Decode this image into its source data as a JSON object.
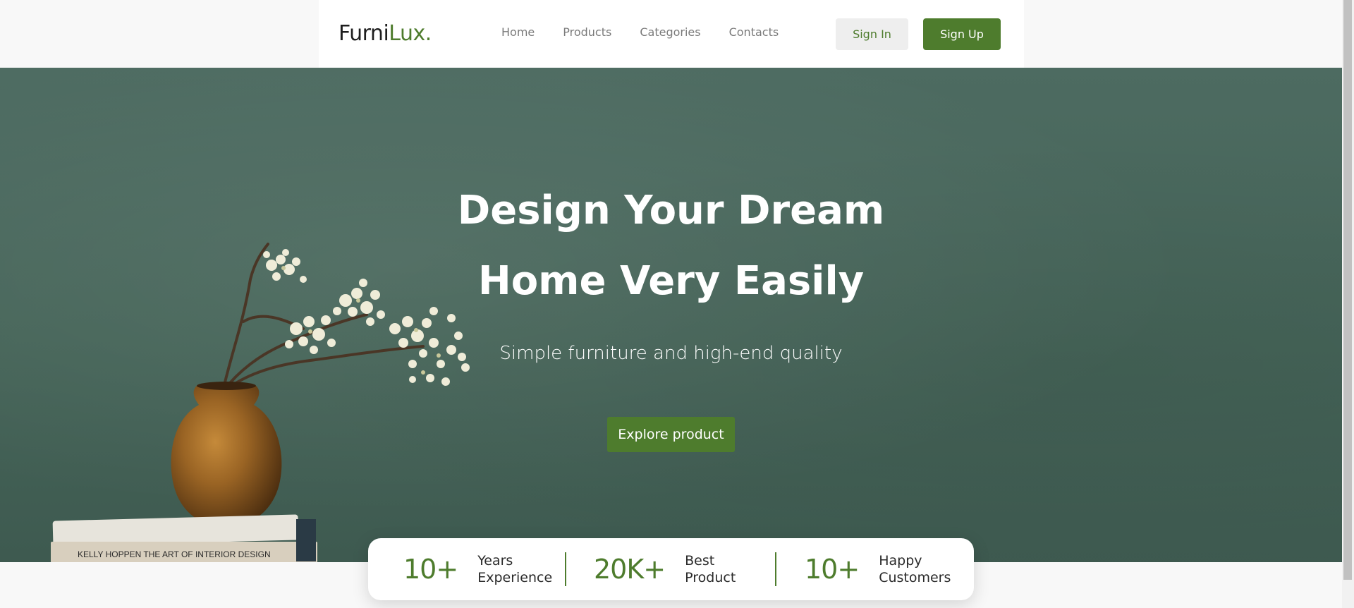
{
  "brand": {
    "name_part1": "Furni",
    "name_part2": "Lux."
  },
  "nav": {
    "links": [
      {
        "label": "Home"
      },
      {
        "label": "Products"
      },
      {
        "label": "Categories"
      },
      {
        "label": "Contacts"
      }
    ],
    "signin_label": "Sign In",
    "signup_label": "Sign Up"
  },
  "hero": {
    "title_line1": "Design Your Dream",
    "title_line2": "Home Very Easily",
    "subtitle": "Simple furniture and high-end quality",
    "cta_label": "Explore product",
    "book_spine_text": "KELLY HOPPEN THE ART OF INTERIOR DESIGN"
  },
  "stats": [
    {
      "number": "10+",
      "label_line1": "Years",
      "label_line2": "Experience"
    },
    {
      "number": "20K+",
      "label_line1": "Best",
      "label_line2": "Product"
    },
    {
      "number": "10+",
      "label_line1": "Happy",
      "label_line2": "Customers"
    }
  ],
  "colors": {
    "brand_green": "#4e7c2d",
    "hero_bg": "#4a665c",
    "signin_bg": "#eeeeee"
  },
  "icons": [
    "vase-with-flowers-image",
    "book-stack-image"
  ]
}
